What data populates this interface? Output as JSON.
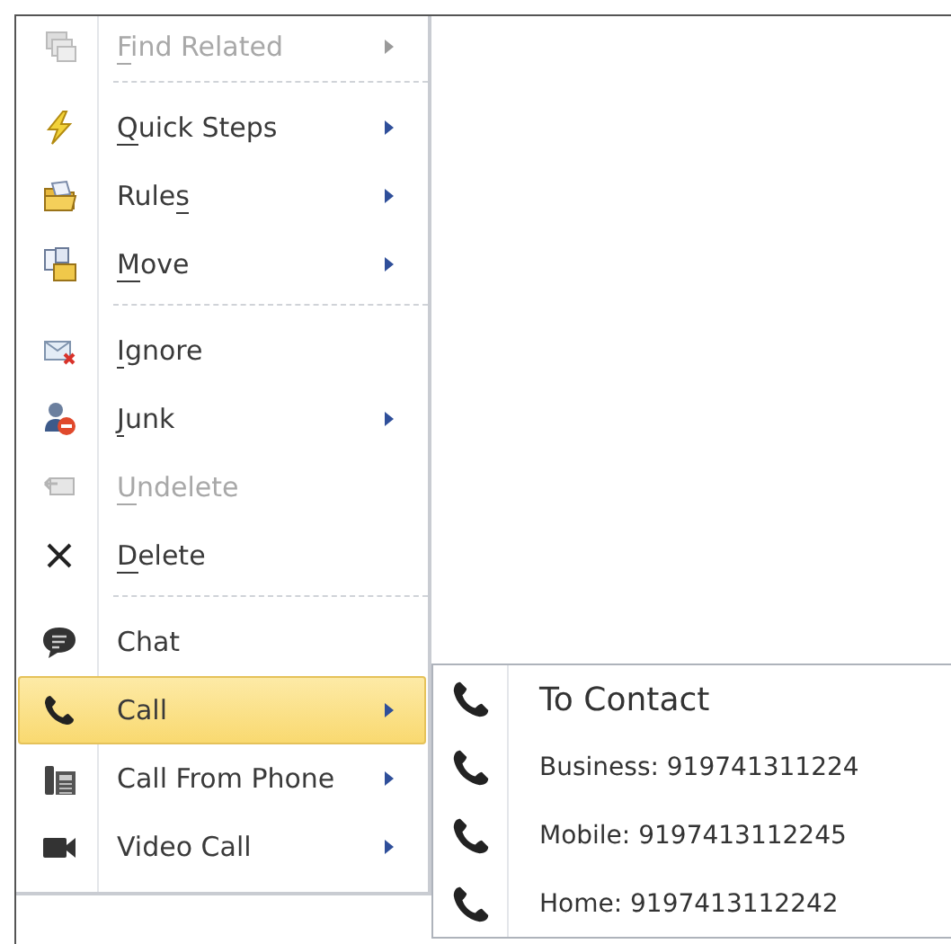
{
  "menu": {
    "items": [
      {
        "kind": "item",
        "label": [
          {
            "text": "F",
            "underlined": true
          },
          {
            "text": "ind Related",
            "underlined": false
          }
        ],
        "disabled": true,
        "selected": false,
        "has_submenu": true
      },
      {
        "kind": "separator"
      },
      {
        "kind": "item",
        "label": [
          {
            "text": "Q",
            "underlined": true
          },
          {
            "text": "uick Steps",
            "underlined": false
          }
        ],
        "disabled": false,
        "selected": false,
        "has_submenu": true
      },
      {
        "kind": "item",
        "label": [
          {
            "text": "Rule",
            "underlined": false
          },
          {
            "text": "s",
            "underlined": true
          }
        ],
        "disabled": false,
        "selected": false,
        "has_submenu": true
      },
      {
        "kind": "item",
        "label": [
          {
            "text": "M",
            "underlined": true
          },
          {
            "text": "ove",
            "underlined": false
          }
        ],
        "disabled": false,
        "selected": false,
        "has_submenu": true
      },
      {
        "kind": "separator"
      },
      {
        "kind": "item",
        "label": [
          {
            "text": "I",
            "underlined": true
          },
          {
            "text": "gnore",
            "underlined": false
          }
        ],
        "disabled": false,
        "selected": false,
        "has_submenu": false
      },
      {
        "kind": "item",
        "label": [
          {
            "text": "J",
            "underlined": true
          },
          {
            "text": "unk",
            "underlined": false
          }
        ],
        "disabled": false,
        "selected": false,
        "has_submenu": true
      },
      {
        "kind": "item",
        "label": [
          {
            "text": "U",
            "underlined": true
          },
          {
            "text": "ndelete",
            "underlined": false
          }
        ],
        "disabled": true,
        "selected": false,
        "has_submenu": false
      },
      {
        "kind": "item",
        "label": [
          {
            "text": "D",
            "underlined": true
          },
          {
            "text": "elete",
            "underlined": false
          }
        ],
        "disabled": false,
        "selected": false,
        "has_submenu": false
      },
      {
        "kind": "separator"
      },
      {
        "kind": "item",
        "label": [
          {
            "text": "Chat",
            "underlined": false
          }
        ],
        "disabled": false,
        "selected": false,
        "has_submenu": false
      },
      {
        "kind": "item",
        "label": [
          {
            "text": "Call",
            "underlined": false
          }
        ],
        "disabled": false,
        "selected": true,
        "has_submenu": true
      },
      {
        "kind": "item",
        "label": [
          {
            "text": "Call From Phone",
            "underlined": false
          }
        ],
        "disabled": false,
        "selected": false,
        "has_submenu": true
      },
      {
        "kind": "item",
        "label": [
          {
            "text": "Video Call",
            "underlined": false
          }
        ],
        "disabled": false,
        "selected": false,
        "has_submenu": true
      }
    ]
  },
  "submenu": {
    "items": [
      {
        "kind": "heading",
        "label": "To Contact"
      },
      {
        "kind": "number",
        "label": "Business: 919741311224"
      },
      {
        "kind": "number",
        "label": "Mobile: 9197413112245"
      },
      {
        "kind": "number",
        "label": "Home: 9197413112242"
      }
    ]
  }
}
